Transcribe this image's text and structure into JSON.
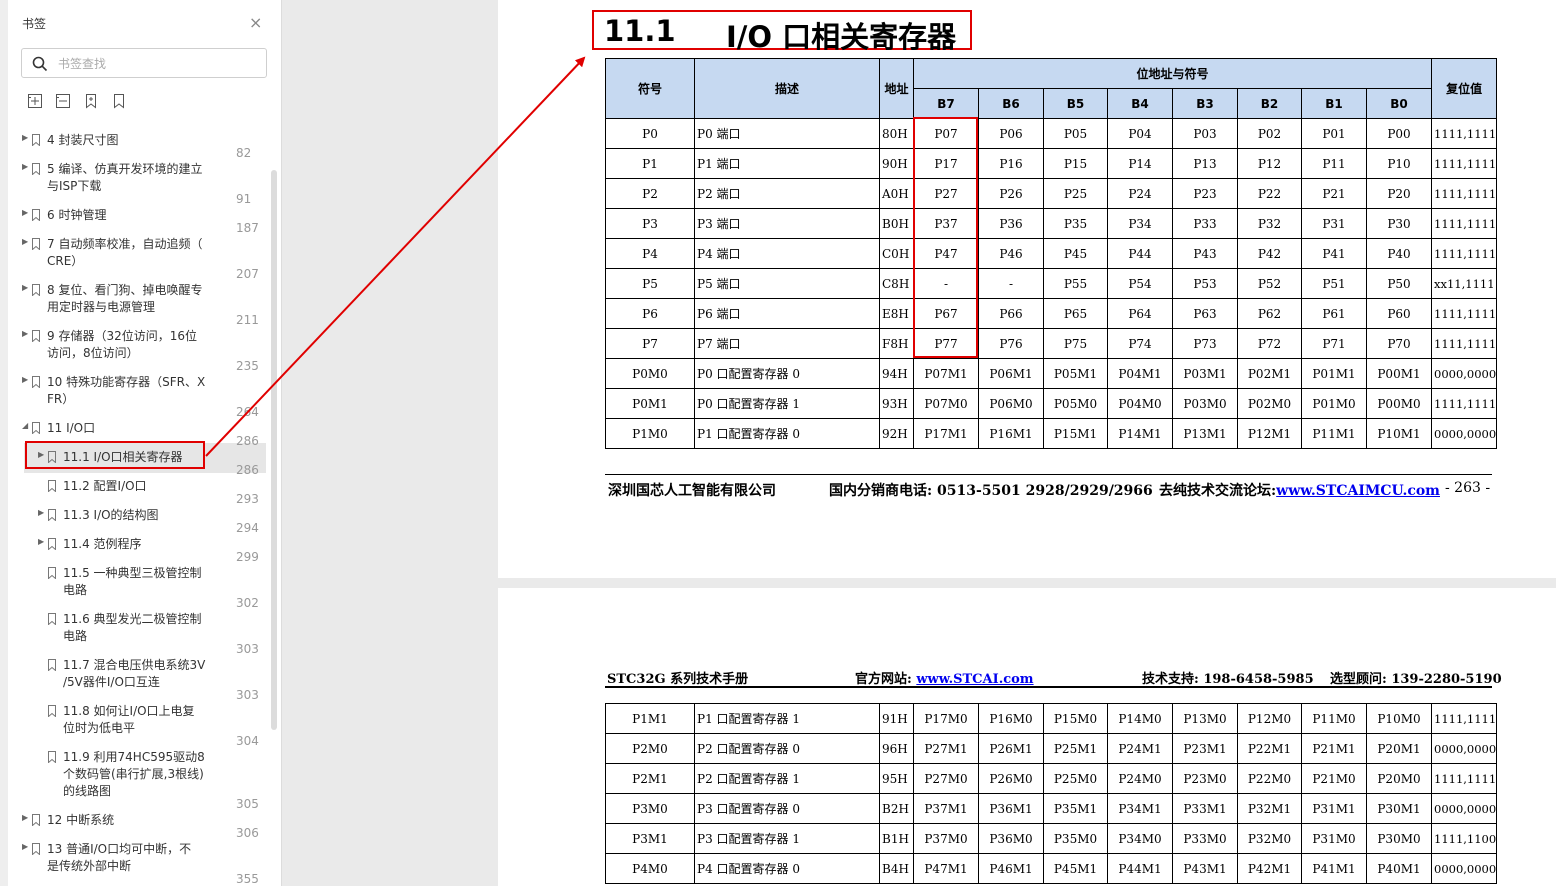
{
  "sidebar": {
    "title": "书签",
    "close_glyph": "×",
    "search_placeholder": "书签查找",
    "toolbar_icons": [
      "expand-all-icon",
      "collapse-all-icon",
      "add-bookmark-icon",
      "bookmark-icon"
    ],
    "items": [
      {
        "label": "4 封装尺寸图",
        "page": "82"
      },
      {
        "label": "5 编译、仿真开发环境的建立\n与ISP下载",
        "page": "91"
      },
      {
        "label": "6 时钟管理",
        "page": "187"
      },
      {
        "label": "7 自动频率校准，自动追频（\nCRE）",
        "page": "207"
      },
      {
        "label": "8 复位、看门狗、掉电唤醒专\n用定时器与电源管理",
        "page": "211"
      },
      {
        "label": "9 存储器（32位访问，16位\n访问，8位访问）",
        "page": "235"
      },
      {
        "label": "10 特殊功能寄存器（SFR、X\nFR）",
        "page": "264"
      },
      {
        "label": "11 I/O口",
        "page": "286"
      },
      {
        "label": "11.1 I/O口相关寄存器",
        "page": "286"
      },
      {
        "label": "11.2 配置I/O口",
        "page": "293"
      },
      {
        "label": "11.3 I/O的结构图",
        "page": "294"
      },
      {
        "label": "11.4 范例程序",
        "page": "299"
      },
      {
        "label": "11.5 一种典型三极管控制\n电路",
        "page": "302"
      },
      {
        "label": "11.6 典型发光二极管控制\n电路",
        "page": "303"
      },
      {
        "label": "11.7 混合电压供电系统3V\n/5V器件I/O口互连",
        "page": "303"
      },
      {
        "label": "11.8 如何让I/O口上电复\n位时为低电平",
        "page": "304"
      },
      {
        "label": "11.9 利用74HC595驱动8\n个数码管(串行扩展,3根线)\n的线路图",
        "page": "305"
      },
      {
        "label": "12 中断系统",
        "page": "306"
      },
      {
        "label": "13 普通I/O口均可中断，不\n是传统外部中断",
        "page": "355"
      }
    ]
  },
  "page1": {
    "section_number": "11.1",
    "section_title": "I/O 口相关寄存器",
    "table": {
      "h_symbol": "符号",
      "h_desc": "描述",
      "h_addr": "地址",
      "h_bits": "位地址与符号",
      "h_reset": "复位值",
      "bit_headers": [
        "B7",
        "B6",
        "B5",
        "B4",
        "B3",
        "B2",
        "B1",
        "B0"
      ],
      "rows": [
        [
          "P0",
          "P0 端口",
          "80H",
          "P07",
          "P06",
          "P05",
          "P04",
          "P03",
          "P02",
          "P01",
          "P00",
          "1111,1111"
        ],
        [
          "P1",
          "P1 端口",
          "90H",
          "P17",
          "P16",
          "P15",
          "P14",
          "P13",
          "P12",
          "P11",
          "P10",
          "1111,1111"
        ],
        [
          "P2",
          "P2 端口",
          "A0H",
          "P27",
          "P26",
          "P25",
          "P24",
          "P23",
          "P22",
          "P21",
          "P20",
          "1111,1111"
        ],
        [
          "P3",
          "P3 端口",
          "B0H",
          "P37",
          "P36",
          "P35",
          "P34",
          "P33",
          "P32",
          "P31",
          "P30",
          "1111,1111"
        ],
        [
          "P4",
          "P4 端口",
          "C0H",
          "P47",
          "P46",
          "P45",
          "P44",
          "P43",
          "P42",
          "P41",
          "P40",
          "1111,1111"
        ],
        [
          "P5",
          "P5 端口",
          "C8H",
          "-",
          "-",
          "P55",
          "P54",
          "P53",
          "P52",
          "P51",
          "P50",
          "xx11,1111"
        ],
        [
          "P6",
          "P6 端口",
          "E8H",
          "P67",
          "P66",
          "P65",
          "P64",
          "P63",
          "P62",
          "P61",
          "P60",
          "1111,1111"
        ],
        [
          "P7",
          "P7 端口",
          "F8H",
          "P77",
          "P76",
          "P75",
          "P74",
          "P73",
          "P72",
          "P71",
          "P70",
          "1111,1111"
        ],
        [
          "P0M0",
          "P0 口配置寄存器 0",
          "94H",
          "P07M1",
          "P06M1",
          "P05M1",
          "P04M1",
          "P03M1",
          "P02M1",
          "P01M1",
          "P00M1",
          "0000,0000"
        ],
        [
          "P0M1",
          "P0 口配置寄存器 1",
          "93H",
          "P07M0",
          "P06M0",
          "P05M0",
          "P04M0",
          "P03M0",
          "P02M0",
          "P01M0",
          "P00M0",
          "1111,1111"
        ],
        [
          "P1M0",
          "P1 口配置寄存器 0",
          "92H",
          "P17M1",
          "P16M1",
          "P15M1",
          "P14M1",
          "P13M1",
          "P12M1",
          "P11M1",
          "P10M1",
          "0000,0000"
        ]
      ]
    },
    "footer": {
      "company": "深圳国芯人工智能有限公司",
      "phone_label": "国内分销商电话: 0513-5501 2928/2929/2966",
      "forum_label": "去纯技术交流论坛:",
      "forum_link": "www.STCAIMCU.com",
      "page_num": "- 263 -"
    }
  },
  "page2": {
    "header": {
      "manual": "STC32G 系列技术手册",
      "site_label": "官方网站: ",
      "site_link": "www.STCAI.com",
      "support": "技术支持: 198-6458-5985",
      "advisor": "选型顾问: 139-2280-5190"
    },
    "table": {
      "rows": [
        [
          "P1M1",
          "P1 口配置寄存器 1",
          "91H",
          "P17M0",
          "P16M0",
          "P15M0",
          "P14M0",
          "P13M0",
          "P12M0",
          "P11M0",
          "P10M0",
          "1111,1111"
        ],
        [
          "P2M0",
          "P2 口配置寄存器 0",
          "96H",
          "P27M1",
          "P26M1",
          "P25M1",
          "P24M1",
          "P23M1",
          "P22M1",
          "P21M1",
          "P20M1",
          "0000,0000"
        ],
        [
          "P2M1",
          "P2 口配置寄存器 1",
          "95H",
          "P27M0",
          "P26M0",
          "P25M0",
          "P24M0",
          "P23M0",
          "P22M0",
          "P21M0",
          "P20M0",
          "1111,1111"
        ],
        [
          "P3M0",
          "P3 口配置寄存器 0",
          "B2H",
          "P37M1",
          "P36M1",
          "P35M1",
          "P34M1",
          "P33M1",
          "P32M1",
          "P31M1",
          "P30M1",
          "0000,0000"
        ],
        [
          "P3M1",
          "P3 口配置寄存器 1",
          "B1H",
          "P37M0",
          "P36M0",
          "P35M0",
          "P34M0",
          "P33M0",
          "P32M0",
          "P31M0",
          "P30M0",
          "1111,1100"
        ],
        [
          "P4M0",
          "P4 口配置寄存器 0",
          "B4H",
          "P47M1",
          "P46M1",
          "P45M1",
          "P44M1",
          "P43M1",
          "P42M1",
          "P41M1",
          "P40M1",
          "0000,0000"
        ]
      ]
    }
  },
  "annotation": {
    "color": "#e00000"
  }
}
